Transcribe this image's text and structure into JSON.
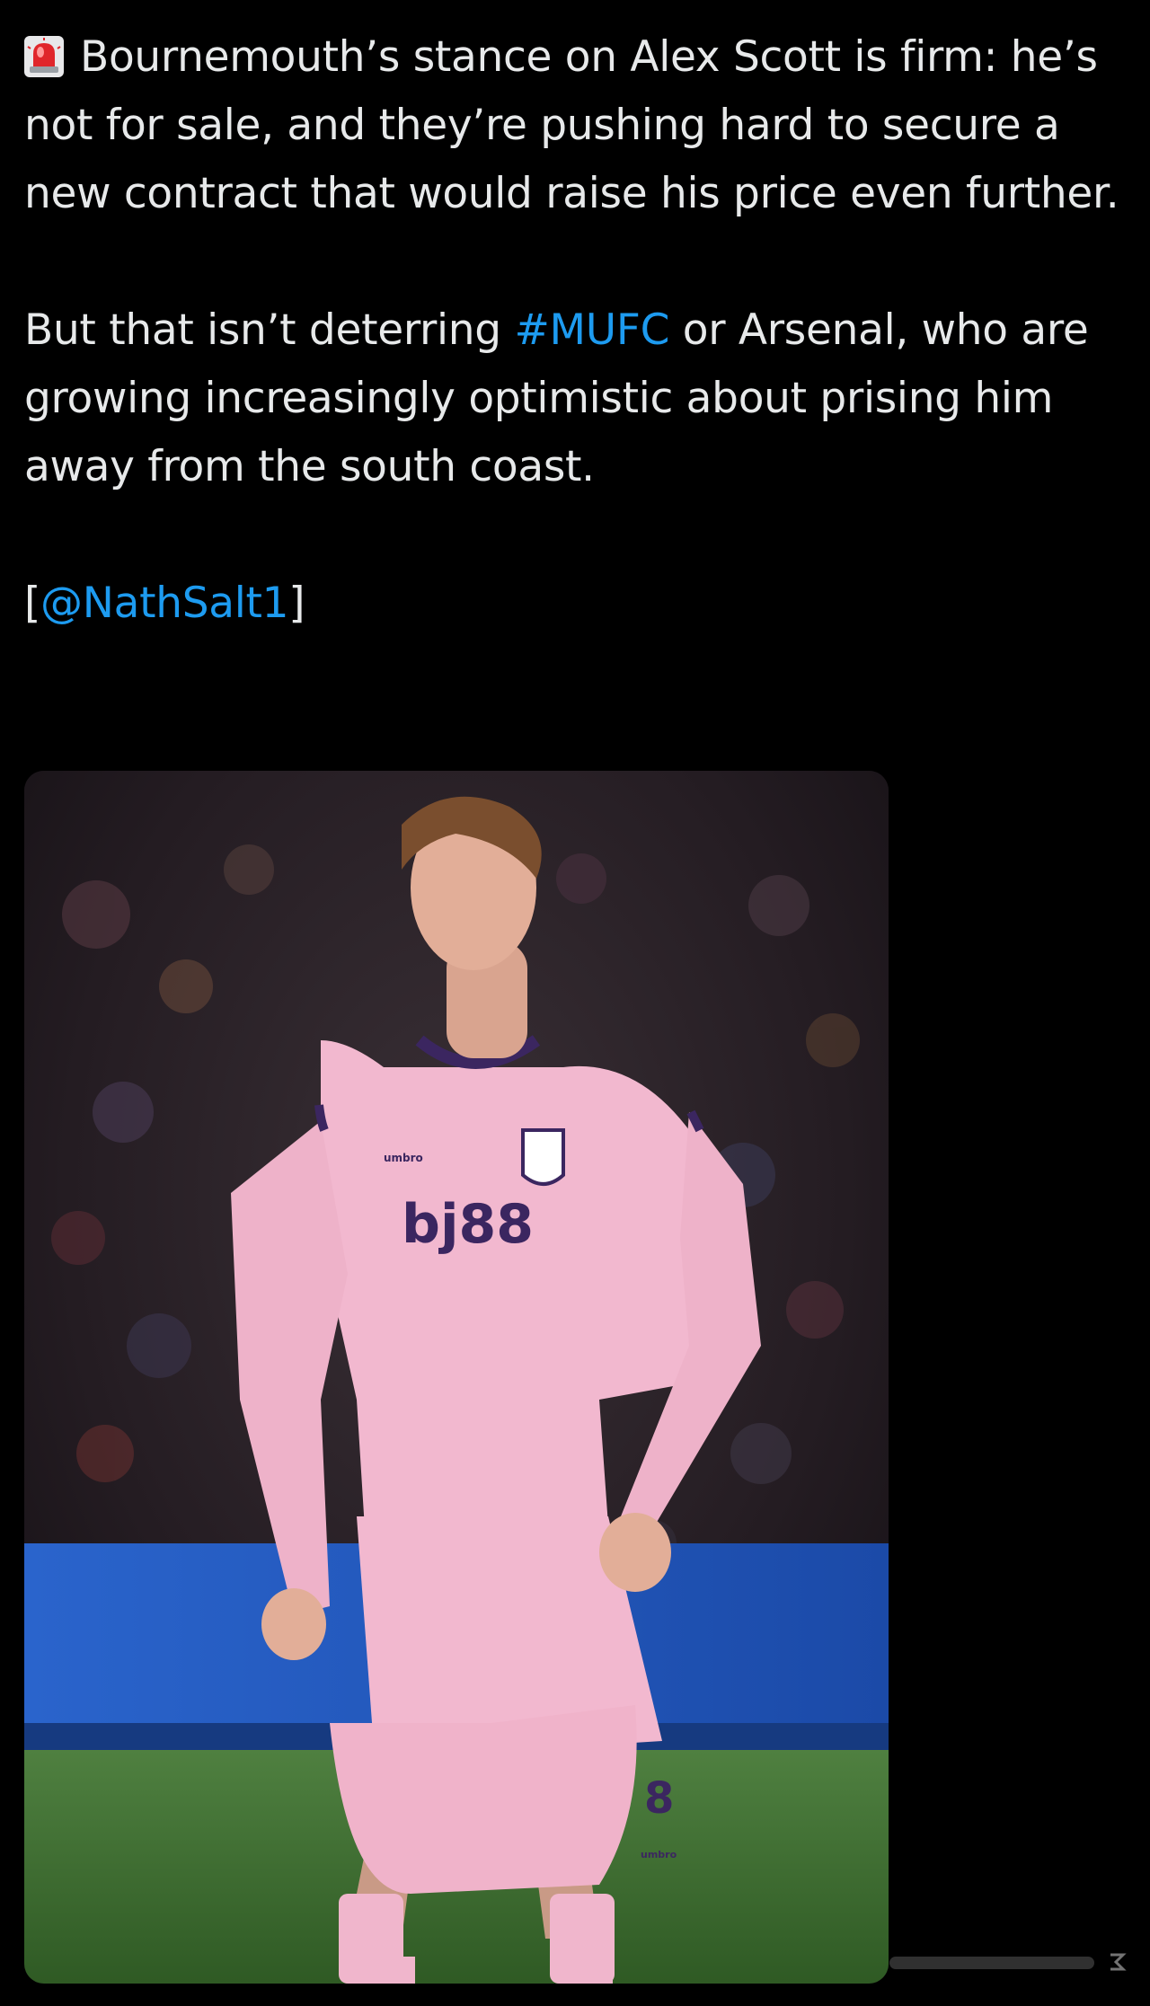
{
  "tweet": {
    "alert_emoji": "🚨",
    "line1": "Bournemouth’s stance on Alex Scott is firm: he’s not for sale, and they’re pushing hard to secure a new contract that would raise his price even further.",
    "para2_before": "But that isn’t deterring ",
    "para2_hashtag": "#MUFC",
    "para2_after": " or Arsenal, who are growing increasingly optimistic about prising him away from the south coast.",
    "credit_open": "[",
    "credit_mention": "@NathSalt1",
    "credit_close": "]"
  },
  "media": {
    "shirt_sponsor": "bj88",
    "kit_brand": "umbro",
    "shorts_number": "8",
    "accent_pink": "#f2b8cf",
    "accent_purple": "#3b2660",
    "pitch_green": "#3e6e2e",
    "board_blue": "#2b63c9"
  },
  "colors": {
    "background": "#000000",
    "text": "#e7e9ea",
    "link": "#1d9bf0"
  }
}
